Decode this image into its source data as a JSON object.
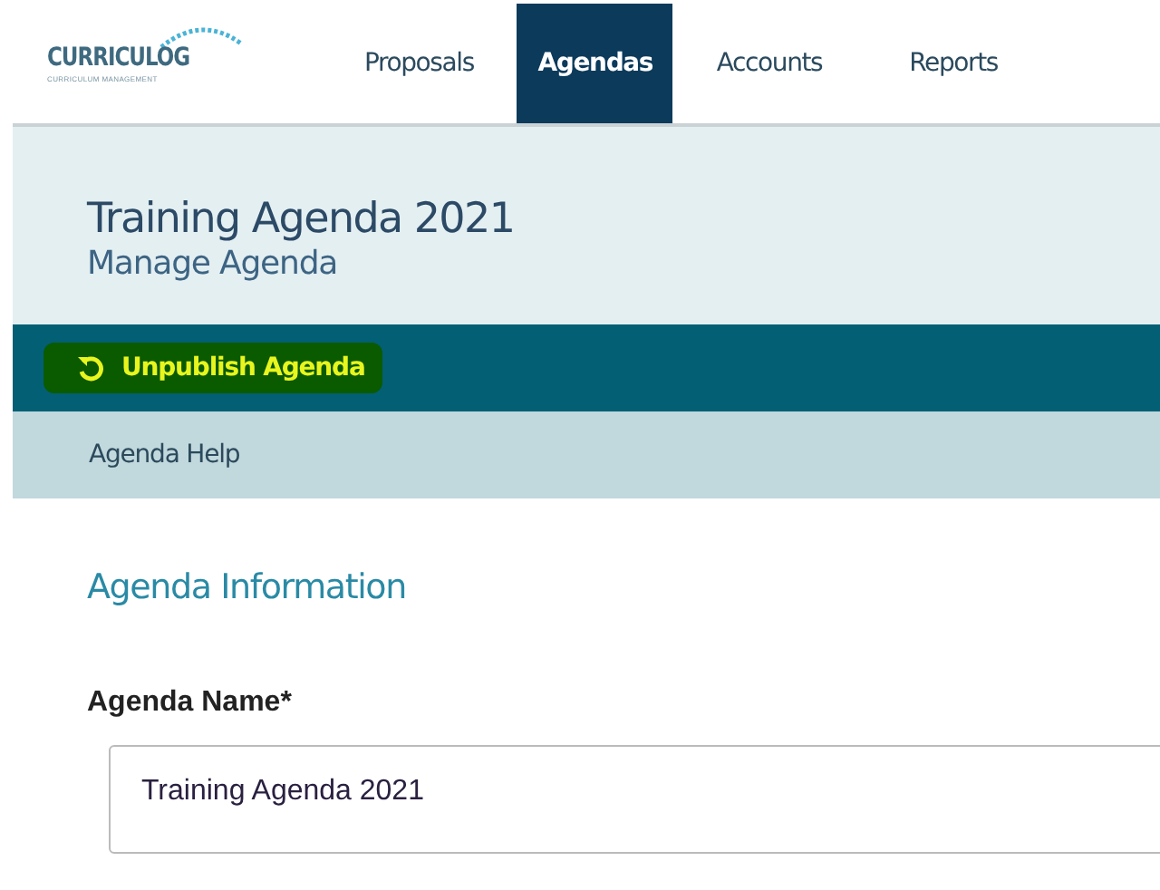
{
  "logo": {
    "name": "CURRICULOG",
    "tagline": "CURRICULUM MANAGEMENT"
  },
  "nav": [
    {
      "label": "Proposals",
      "selected": false
    },
    {
      "label": "Agendas",
      "selected": true
    },
    {
      "label": "Accounts",
      "selected": false
    },
    {
      "label": "Reports",
      "selected": false
    }
  ],
  "header": {
    "title": "Training Agenda 2021",
    "subtitle": "Manage Agenda"
  },
  "action_bar": {
    "action": {
      "label": "Unpublish Agenda",
      "highlighted": true
    }
  },
  "help_bar": {
    "link": "Agenda Help"
  },
  "section": {
    "title": "Agenda Information"
  },
  "field": {
    "label": "Agenda Name*",
    "value": "Training Agenda 2021"
  }
}
